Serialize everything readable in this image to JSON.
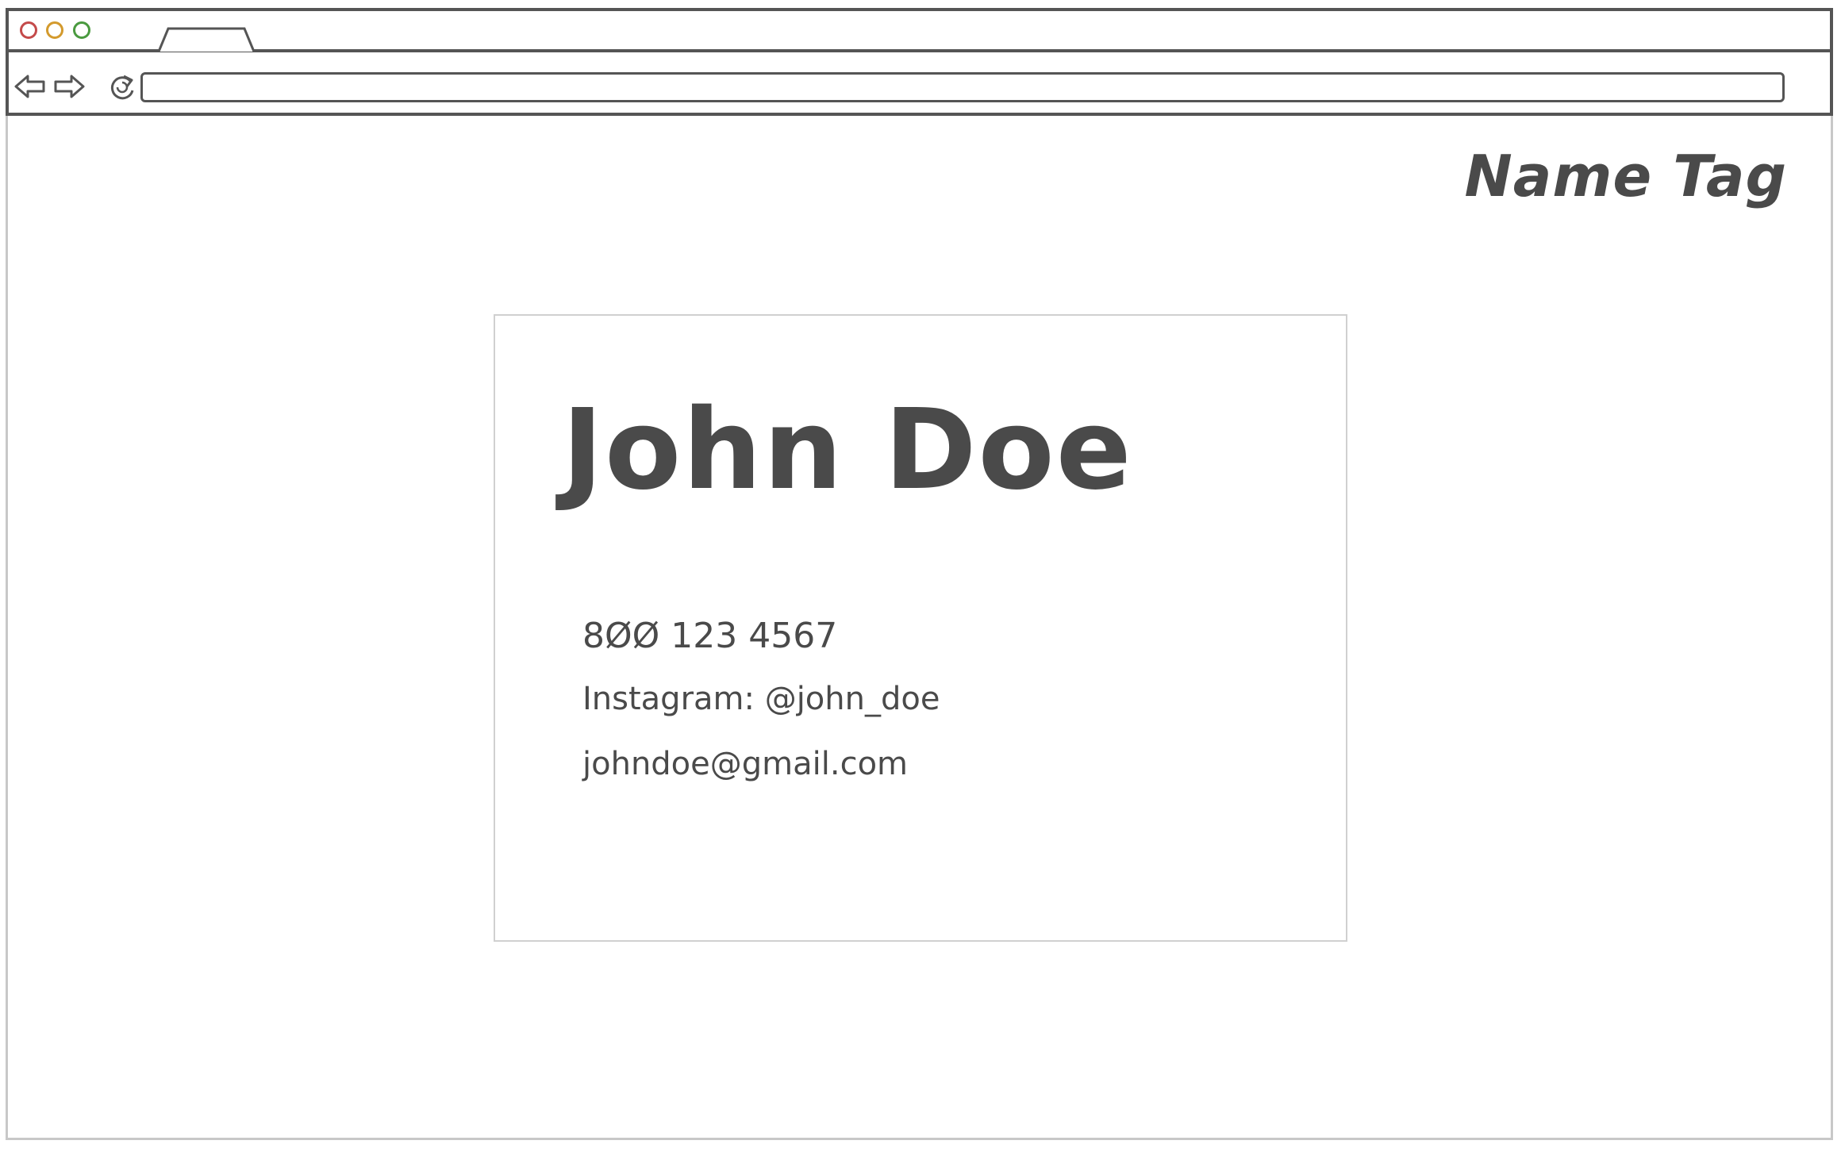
{
  "browser": {
    "url": "",
    "traffic_lights": [
      "close",
      "minimize",
      "maximize"
    ],
    "colors": {
      "close": "#c44a4a",
      "minimize": "#d39a2d",
      "maximize": "#4a9a3f",
      "chrome_border": "#555555"
    }
  },
  "header": {
    "site_title": "Name Tag"
  },
  "card": {
    "name": "John Doe",
    "phone": "8ØØ 123 4567",
    "instagram": "Instagram: @john_doe",
    "email": "johndoe@gmail.com"
  }
}
